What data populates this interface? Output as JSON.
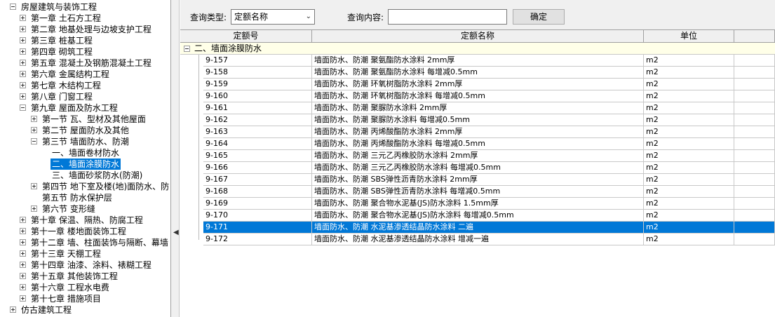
{
  "tree": {
    "items": [
      {
        "label": "房屋建筑与装饰工程",
        "level": 0,
        "state": "minus"
      },
      {
        "label": "第一章 土石方工程",
        "level": 1,
        "state": "plus"
      },
      {
        "label": "第二章 地基处理与边坡支护工程",
        "level": 1,
        "state": "plus"
      },
      {
        "label": "第三章 桩基工程",
        "level": 1,
        "state": "plus"
      },
      {
        "label": "第四章 砌筑工程",
        "level": 1,
        "state": "plus"
      },
      {
        "label": "第五章 混凝土及钢筋混凝土工程",
        "level": 1,
        "state": "plus"
      },
      {
        "label": "第六章 金属结构工程",
        "level": 1,
        "state": "plus"
      },
      {
        "label": "第七章 木结构工程",
        "level": 1,
        "state": "plus"
      },
      {
        "label": "第八章 门窗工程",
        "level": 1,
        "state": "plus"
      },
      {
        "label": "第九章 屋面及防水工程",
        "level": 1,
        "state": "minus"
      },
      {
        "label": "第一节 瓦、型材及其他屋面",
        "level": 2,
        "state": "plus"
      },
      {
        "label": "第二节 屋面防水及其他",
        "level": 2,
        "state": "plus"
      },
      {
        "label": "第三节 墙面防水、防潮",
        "level": 2,
        "state": "minus"
      },
      {
        "label": "一、墙面卷材防水",
        "level": 3,
        "state": "none"
      },
      {
        "label": "二、墙面涂膜防水",
        "level": 3,
        "state": "none",
        "selected": true
      },
      {
        "label": "三、墙面砂浆防水(防潮)",
        "level": 3,
        "state": "none"
      },
      {
        "label": "第四节 地下室及楼(地)面防水、防",
        "level": 2,
        "state": "plus"
      },
      {
        "label": "第五节 防水保护层",
        "level": 2,
        "state": "none"
      },
      {
        "label": "第六节 变形缝",
        "level": 2,
        "state": "plus"
      },
      {
        "label": "第十章 保温、隔热、防腐工程",
        "level": 1,
        "state": "plus"
      },
      {
        "label": "第十一章 楼地面装饰工程",
        "level": 1,
        "state": "plus"
      },
      {
        "label": "第十二章 墙、柱面装饰与隔断、幕墙",
        "level": 1,
        "state": "plus"
      },
      {
        "label": "第十三章 天棚工程",
        "level": 1,
        "state": "plus"
      },
      {
        "label": "第十四章 油漆、涂料、裱糊工程",
        "level": 1,
        "state": "plus"
      },
      {
        "label": "第十五章 其他装饰工程",
        "level": 1,
        "state": "plus"
      },
      {
        "label": "第十六章 工程水电费",
        "level": 1,
        "state": "plus"
      },
      {
        "label": "第十七章 措施项目",
        "level": 1,
        "state": "plus"
      },
      {
        "label": "仿古建筑工程",
        "level": 0,
        "state": "plus"
      }
    ]
  },
  "query": {
    "type_label": "查询类型:",
    "type_value": "定额名称",
    "content_label": "查询内容:",
    "content_value": "",
    "confirm_label": "确定"
  },
  "grid": {
    "headers": [
      "定额号",
      "定额名称",
      "单位",
      ""
    ],
    "group_label": "二、墙面涂膜防水",
    "rows": [
      {
        "code": "9-157",
        "name": "墙面防水、防潮 聚氨酯防水涂料 2mm厚",
        "unit": "m2"
      },
      {
        "code": "9-158",
        "name": "墙面防水、防潮 聚氨酯防水涂料 每增减0.5mm",
        "unit": "m2"
      },
      {
        "code": "9-159",
        "name": "墙面防水、防潮 环氧树脂防水涂料 2mm厚",
        "unit": "m2"
      },
      {
        "code": "9-160",
        "name": "墙面防水、防潮 环氧树脂防水涂料 每增减0.5mm",
        "unit": "m2"
      },
      {
        "code": "9-161",
        "name": "墙面防水、防潮 聚脲防水涂料 2mm厚",
        "unit": "m2"
      },
      {
        "code": "9-162",
        "name": "墙面防水、防潮 聚脲防水涂料 每增减0.5mm",
        "unit": "m2"
      },
      {
        "code": "9-163",
        "name": "墙面防水、防潮 丙烯酸酯防水涂料 2mm厚",
        "unit": "m2"
      },
      {
        "code": "9-164",
        "name": "墙面防水、防潮 丙烯酸酯防水涂料 每增减0.5mm",
        "unit": "m2"
      },
      {
        "code": "9-165",
        "name": "墙面防水、防潮 三元乙丙橡胶防水涂料 2mm厚",
        "unit": "m2"
      },
      {
        "code": "9-166",
        "name": "墙面防水、防潮 三元乙丙橡胶防水涂料 每增减0.5mm",
        "unit": "m2"
      },
      {
        "code": "9-167",
        "name": "墙面防水、防潮 SBS弹性沥青防水涂料 2mm厚",
        "unit": "m2"
      },
      {
        "code": "9-168",
        "name": "墙面防水、防潮 SBS弹性沥青防水涂料 每增减0.5mm",
        "unit": "m2"
      },
      {
        "code": "9-169",
        "name": "墙面防水、防潮 聚合物水泥基(JS)防水涂料 1.5mm厚",
        "unit": "m2"
      },
      {
        "code": "9-170",
        "name": "墙面防水、防潮 聚合物水泥基(JS)防水涂料 每增减0.5mm",
        "unit": "m2"
      },
      {
        "code": "9-171",
        "name": "墙面防水、防潮 水泥基渗透结晶防水涂料 二遍",
        "unit": "m2",
        "selected": true
      },
      {
        "code": "9-172",
        "name": "墙面防水、防潮 水泥基渗透结晶防水涂料 增减一遍",
        "unit": "m2"
      }
    ]
  },
  "colors": {
    "selection": "#0078d7",
    "group_bg": "#ffffe8"
  }
}
